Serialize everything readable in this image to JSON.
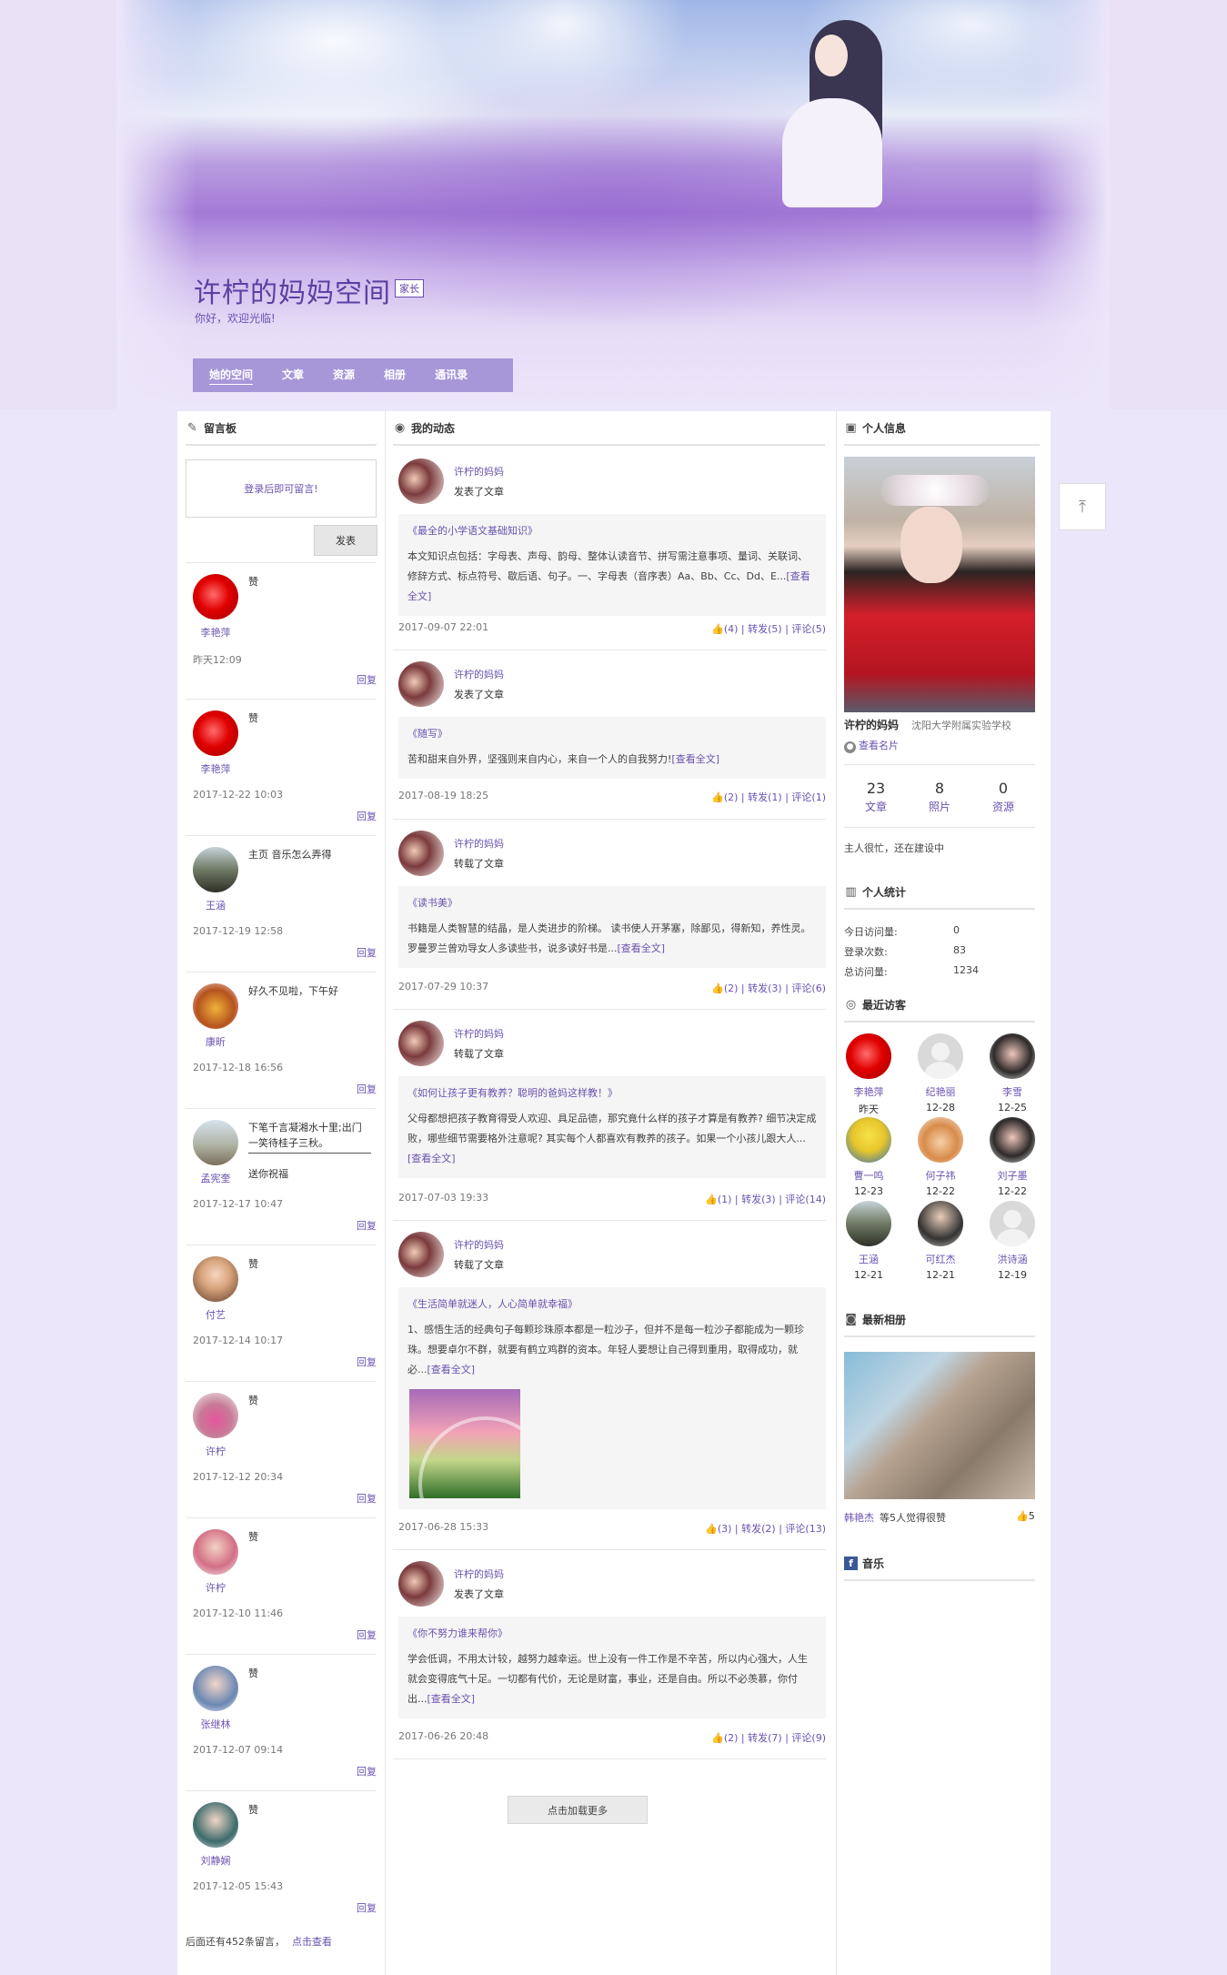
{
  "site": {
    "title": "许柠的妈妈空间",
    "badge": "家长",
    "welcome": "你好，欢迎光临!"
  },
  "nav": [
    {
      "label": "她的空间",
      "active": true
    },
    {
      "label": "文章"
    },
    {
      "label": "资源"
    },
    {
      "label": "相册"
    },
    {
      "label": "通讯录"
    }
  ],
  "guestbook": {
    "title": "留言板",
    "login_prompt": "登录后即可留言!",
    "post_label": "发表",
    "reply_label": "回复",
    "messages": [
      {
        "name": "李艳萍",
        "text": "赞",
        "time": "昨天12:09",
        "avatar": "red-rose"
      },
      {
        "name": "李艳萍",
        "text": "赞",
        "time": "2017-12-22 10:03",
        "avatar": "red-rose"
      },
      {
        "name": "王涵",
        "text": "主页 音乐怎么弄得",
        "time": "2017-12-19 12:58",
        "avatar": "man-photo"
      },
      {
        "name": "康昕",
        "text": "好久不见啦，下午好",
        "time": "2017-12-18 16:56",
        "avatar": "bee-photo"
      },
      {
        "name": "孟宪奎",
        "text": "下笔千言凝湘水十里;出门一笑待桂子三秋。",
        "reply": "送你祝福",
        "time": "2017-12-17 10:47",
        "avatar": "bonsai-photo"
      },
      {
        "name": "付艺",
        "text": "赞",
        "time": "2017-12-14 10:17",
        "avatar": "girl-photo"
      },
      {
        "name": "许柠",
        "text": "赞",
        "time": "2017-12-12 20:34",
        "avatar": "flower-girl"
      },
      {
        "name": "许柠",
        "text": "赞",
        "time": "2017-12-10 11:46",
        "avatar": "pink-girl"
      },
      {
        "name": "张继林",
        "text": "赞",
        "time": "2017-12-07 09:14",
        "avatar": "boy-photo"
      },
      {
        "name": "刘静娴",
        "text": "赞",
        "time": "2017-12-05 15:43",
        "avatar": "woman-photo"
      }
    ],
    "more_text": "后面还有452条留言，",
    "more_link": "点击查看"
  },
  "feed": {
    "title": "我的动态",
    "load_more": "点击加载更多",
    "posts": [
      {
        "author": "许柠的妈妈",
        "action": "发表了文章",
        "title": "《最全的小学语文基础知识》",
        "body": "本文知识点包括：字母表、声母、韵母、整体认读音节、拼写需注意事项、量词、关联词、修辞方式、标点符号、歇后语、句子。一、字母表（音序表）Aa、Bb、Cc、Dd、E...",
        "read_more": "[查看全文]",
        "time": "2017-09-07 22:01",
        "likes": "(4)",
        "shares": "转发(5)",
        "comments": "评论(5)"
      },
      {
        "author": "许柠的妈妈",
        "action": "发表了文章",
        "title": "《随写》",
        "body": "苦和甜来自外界，坚强则来自内心，来自一个人的自我努力!",
        "read_more": "[查看全文]",
        "time": "2017-08-19 18:25",
        "likes": "(2)",
        "shares": "转发(1)",
        "comments": "评论(1)"
      },
      {
        "author": "许柠的妈妈",
        "action": "转载了文章",
        "title": "《读书美》",
        "body": "书籍是人类智慧的结晶，是人类进步的阶梯。 读书使人开茅塞，除鄙见，得新知，养性灵。 罗曼罗兰曾劝导女人多读些书，说多读好书是...",
        "read_more": "[查看全文]",
        "time": "2017-07-29 10:37",
        "likes": "(2)",
        "shares": "转发(3)",
        "comments": "评论(6)"
      },
      {
        "author": "许柠的妈妈",
        "action": "转载了文章",
        "title": "《如何让孩子更有教养？聪明的爸妈这样教！》",
        "body": "父母都想把孩子教育得受人欢迎、具足品德，那究竟什么样的孩子才算是有教养? 细节决定成败，哪些细节需要格外注意呢? 其实每个人都喜欢有教养的孩子。如果一个小孩儿跟大人...",
        "read_more": "[查看全文]",
        "time": "2017-07-03 19:33",
        "likes": "(1)",
        "shares": "转发(3)",
        "comments": "评论(14)"
      },
      {
        "author": "许柠的妈妈",
        "action": "转载了文章",
        "title": "《生活简单就迷人，人心简单就幸福》",
        "body": "1、感悟生活的经典句子每颗珍珠原本都是一粒沙子，但并不是每一粒沙子都能成为一颗珍珠。想要卓尔不群，就要有鹤立鸡群的资本。年轻人要想让自己得到重用，取得成功，就必...",
        "read_more": "[查看全文]",
        "has_image": true,
        "time": "2017-06-28 15:33",
        "likes": "(3)",
        "shares": "转发(2)",
        "comments": "评论(13)"
      },
      {
        "author": "许柠的妈妈",
        "action": "发表了文章",
        "title": "《你不努力谁来帮你》",
        "body": "学会低调，不用太计较，越努力越幸运。世上没有一件工作是不辛苦，所以内心强大，人生就会变得底气十足。一切都有代价，无论是财富，事业，还是自由。所以不必羡慕，你付出...",
        "read_more": "[查看全文]",
        "time": "2017-06-26 20:48",
        "likes": "(2)",
        "shares": "转发(7)",
        "comments": "评论(9)"
      }
    ]
  },
  "profile": {
    "title": "个人信息",
    "name": "许柠的妈妈",
    "school": "沈阳大学附属实验学校",
    "view_card": "查看名片",
    "stats": [
      {
        "num": "23",
        "label": "文章"
      },
      {
        "num": "8",
        "label": "照片"
      },
      {
        "num": "0",
        "label": "资源"
      }
    ],
    "busy": "主人很忙，还在建设中"
  },
  "personal_stats": {
    "title": "个人统计",
    "rows": [
      {
        "k": "今日访问量:",
        "v": "0"
      },
      {
        "k": "登录次数:",
        "v": "83"
      },
      {
        "k": "总访问量:",
        "v": "1234"
      }
    ]
  },
  "visitors": {
    "title": "最近访客",
    "list": [
      {
        "name": "李艳萍",
        "date": "昨天",
        "avatar": "red-rose"
      },
      {
        "name": "纪艳丽",
        "date": "12-28",
        "avatar": "default"
      },
      {
        "name": "李雪",
        "date": "12-25",
        "avatar": "couple-photo"
      },
      {
        "name": "曹一鸣",
        "date": "12-23",
        "avatar": "minion"
      },
      {
        "name": "何子祎",
        "date": "12-22",
        "avatar": "cartoon-girl"
      },
      {
        "name": "刘子墨",
        "date": "12-22",
        "avatar": "couple-photo"
      },
      {
        "name": "王涵",
        "date": "12-21",
        "avatar": "man-photo"
      },
      {
        "name": "可红杰",
        "date": "12-21",
        "avatar": "old-man"
      },
      {
        "name": "洪诗涵",
        "date": "12-19",
        "avatar": "default"
      }
    ]
  },
  "album": {
    "title": "最新相册",
    "uploader": "韩艳杰",
    "caption": "等5人觉得很赞",
    "likes": "5"
  },
  "music": {
    "title": "音乐"
  },
  "colors": {
    "accent": "#6a52b0",
    "nav_bg": "#a797d9",
    "page_bg": "#ece6fa"
  }
}
